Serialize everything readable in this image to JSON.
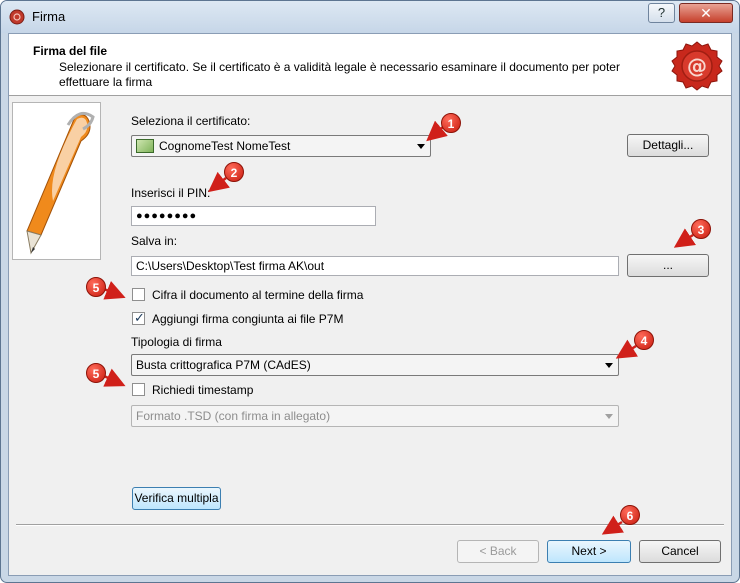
{
  "window": {
    "title": "Firma",
    "help_label": "?",
    "close_label": "✕"
  },
  "header": {
    "title": "Firma del file",
    "description": "Selezionare il certificato. Se il certificato è a validità legale è necessario esaminare il documento per poter effettuare la firma"
  },
  "certificate": {
    "label": "Seleziona il certificato:",
    "selected": "CognomeTest NomeTest",
    "details_button": "Dettagli..."
  },
  "pin": {
    "label": "Inserisci il PIN:",
    "value": "●●●●●●●●"
  },
  "save": {
    "label": "Salva in:",
    "path": "C:\\Users\\Desktop\\Test firma AK\\out",
    "browse_button": "..."
  },
  "options": {
    "encrypt": {
      "label": "Cifra il documento al termine della firma",
      "checked": false
    },
    "cosign": {
      "label": "Aggiungi firma congiunta ai file P7M",
      "checked": true
    }
  },
  "signature_type": {
    "label": "Tipologia di firma",
    "selected": "Busta crittografica P7M (CAdES)"
  },
  "timestamp": {
    "label": "Richiedi timestamp",
    "checked": false,
    "format": "Formato .TSD (con firma in allegato)"
  },
  "verify_button": "Verifica multipla",
  "nav": {
    "back": "< Back",
    "next": "Next >",
    "cancel": "Cancel"
  },
  "callouts": [
    "1",
    "2",
    "3",
    "4",
    "5",
    "5",
    "6"
  ],
  "colors": {
    "callout": "#d0201a",
    "accent": "#3c7fb1"
  }
}
